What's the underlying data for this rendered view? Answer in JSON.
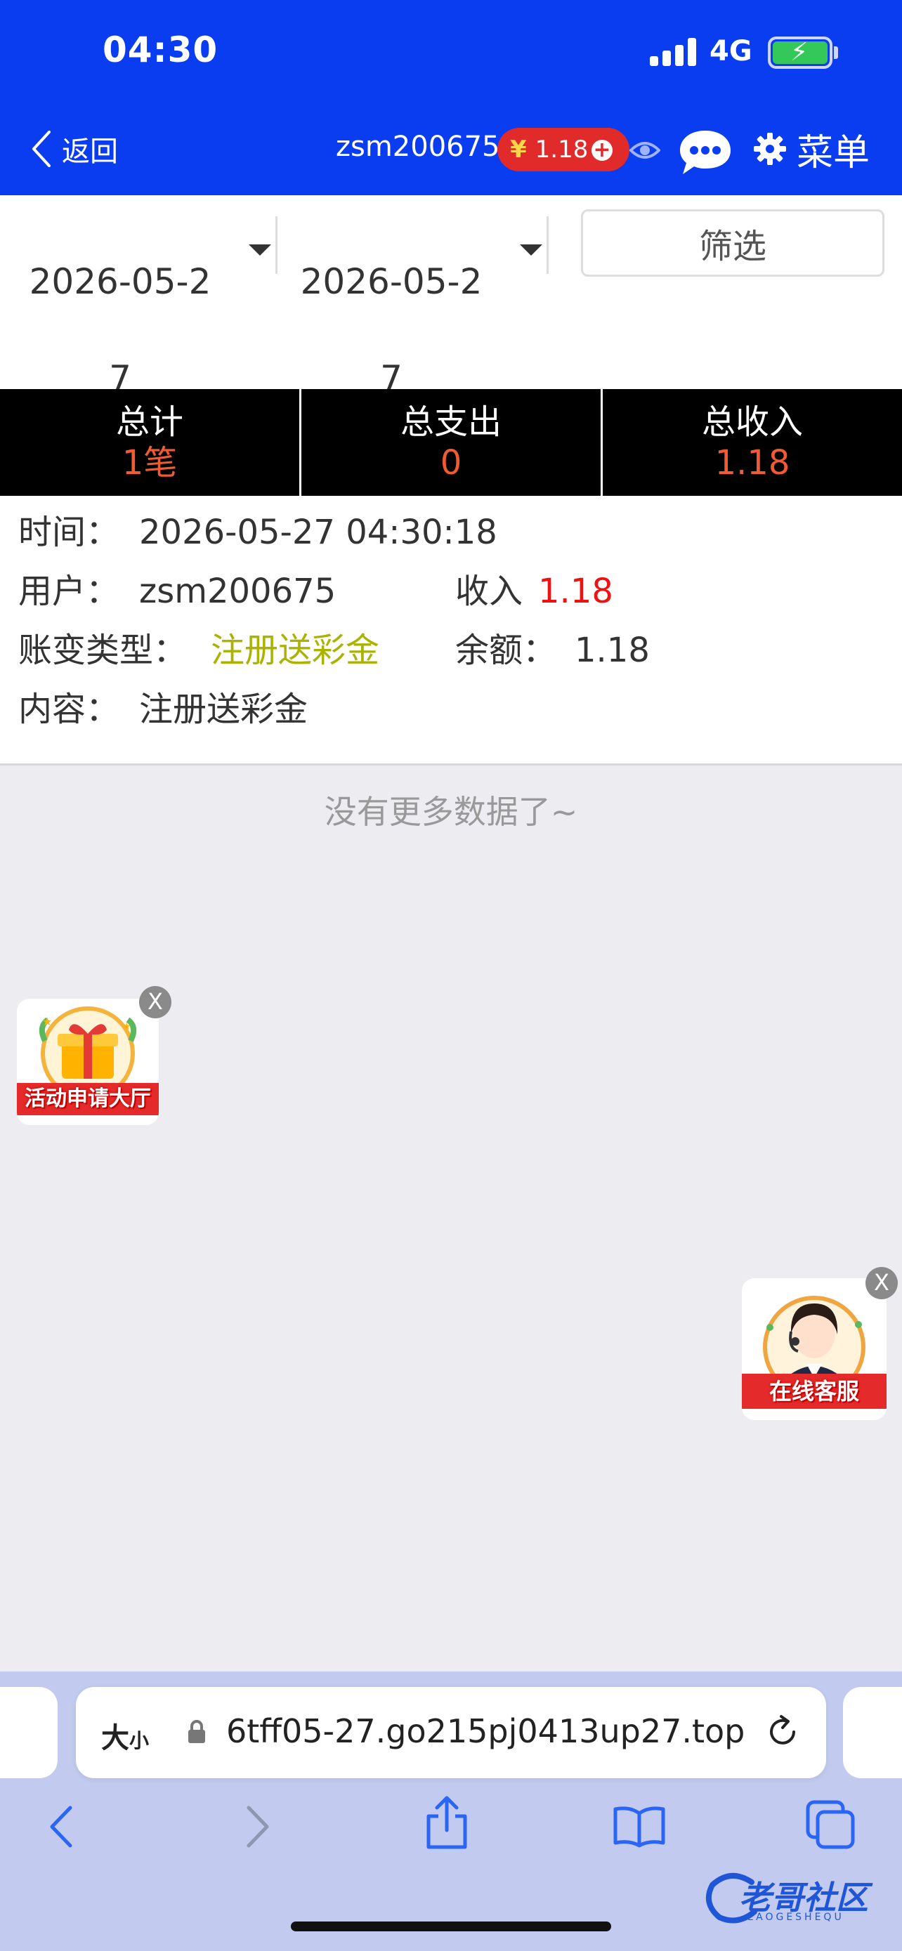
{
  "status_bar": {
    "time": "04:30",
    "network": "4G"
  },
  "nav": {
    "back_label": "返回",
    "username": "zsm200675",
    "balance_symbol": "¥",
    "balance": "1.18",
    "menu_label": "菜单"
  },
  "filter": {
    "start_date": "2026-05-27",
    "end_date": "2026-05-27",
    "filter_label": "筛选"
  },
  "summary": {
    "total_label": "总计",
    "total_value": "1笔",
    "expense_label": "总支出",
    "expense_value": "0",
    "income_label": "总收入",
    "income_value": "1.18"
  },
  "record": {
    "time_key": "时间：",
    "time_value": "2026-05-27 04:30:18",
    "user_key": "用户：",
    "user_value": "zsm200675",
    "income_key": "收入",
    "income_value": "1.18",
    "type_key": "账变类型：",
    "type_value": "注册送彩金",
    "balance_key": "余额：",
    "balance_value": "1.18",
    "content_key": "内容：",
    "content_value": "注册送彩金"
  },
  "no_more": "没有更多数据了~",
  "ads": {
    "activity_caption": "活动申请大厅",
    "service_caption": "在线客服",
    "close_label": "X"
  },
  "browser": {
    "text_size_label": "大",
    "text_size_small": "小",
    "url": "6tff05-27.go215pj0413up27.top"
  },
  "watermark": {
    "text": "老哥社区",
    "sub": "LAOGESHEQU"
  },
  "colors": {
    "header_blue": "#0a3cf0",
    "accent_red": "#f25a32",
    "income_red": "#ee1111",
    "type_olive": "#a9b300"
  }
}
